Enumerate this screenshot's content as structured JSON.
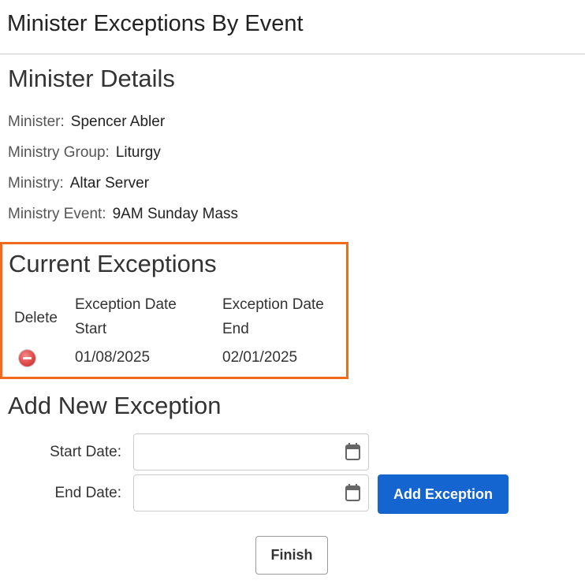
{
  "page": {
    "title": "Minister Exceptions By Event"
  },
  "details": {
    "heading": "Minister Details",
    "rows": [
      {
        "label": "Minister:",
        "value": "Spencer Abler"
      },
      {
        "label": "Ministry Group:",
        "value": "Liturgy"
      },
      {
        "label": "Ministry:",
        "value": "Altar Server"
      },
      {
        "label": "Ministry Event:",
        "value": "9AM Sunday Mass"
      }
    ]
  },
  "exceptions": {
    "heading": "Current Exceptions",
    "columns": {
      "delete": "Delete",
      "start_line1": "Exception Date",
      "start_line2": "Start",
      "end_line1": "Exception Date",
      "end_line2": "End"
    },
    "rows": [
      {
        "start": "01/08/2025",
        "end": "02/01/2025",
        "delete_icon": "remove-circle-icon"
      }
    ],
    "highlight_color": "#f26b1d"
  },
  "add_exception": {
    "heading": "Add New Exception",
    "start_label": "Start Date:",
    "end_label": "End Date:",
    "start_value": "",
    "end_value": "",
    "calendar_icon": "calendar-icon",
    "add_button_label": "Add Exception",
    "add_button_color": "#1565d1"
  },
  "footer": {
    "finish_label": "Finish"
  }
}
